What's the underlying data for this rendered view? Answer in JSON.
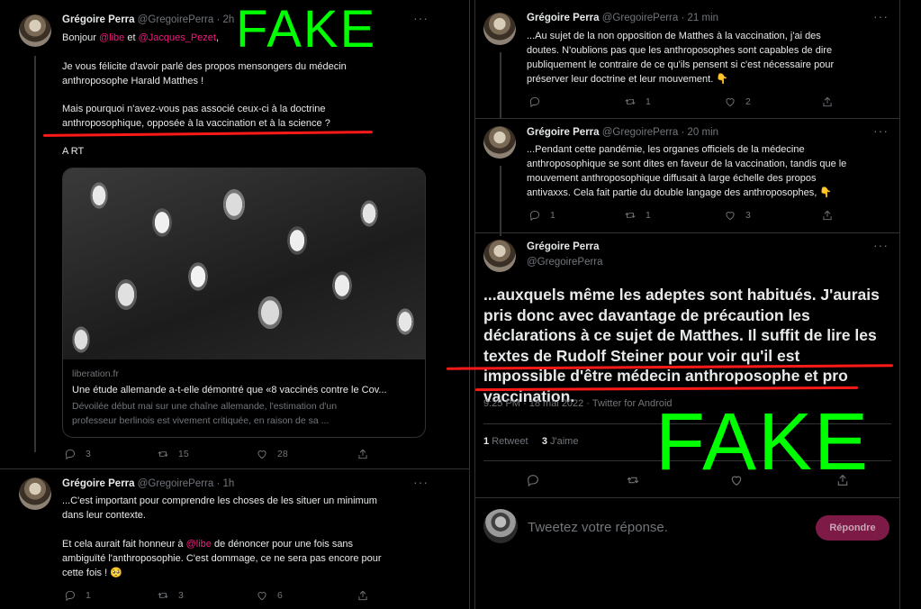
{
  "left": {
    "tweet1": {
      "name": "Grégoire Perra",
      "handle": "@GregoirePerra · 2h",
      "greeting_pre": "Bonjour ",
      "mention1": "@libe",
      "greeting_mid": " et ",
      "mention2": "@Jacques_Pezet",
      "greeting_post": ",",
      "para1": "Je vous félicite d'avoir parlé des propos mensongers du médecin\nanthroposophe Harald Matthes !",
      "para2": "Mais pourquoi n'avez-vous pas associé ceux-ci à la doctrine\nanthroposophique, opposée à la vaccination et à la science ?",
      "para3": "A RT",
      "card": {
        "domain": "liberation.fr",
        "title": "Une étude allemande a-t-elle démontré que «8 vaccinés contre le Cov...",
        "desc": "Dévoilée début mai sur une chaîne allemande, l'estimation d'un\nprofesseur berlinois est vivement critiquée, en raison de sa ..."
      },
      "replies": "3",
      "retweets": "15",
      "likes": "28"
    },
    "tweet2": {
      "name": "Grégoire Perra",
      "handle": "@GregoirePerra · 1h",
      "para1": "...C'est important pour comprendre les choses de les situer un minimum\ndans leur contexte.",
      "para2_pre": "Et cela aurait fait honneur à ",
      "mention": "@libe",
      "para2_post": " de dénoncer pour une fois sans",
      "para2_rest": "ambiguïté l'anthroposophie. C'est dommage, ce ne sera pas encore pour\ncette fois ! 🥺",
      "replies": "1",
      "retweets": "3",
      "likes": "6"
    }
  },
  "right": {
    "tweet1": {
      "name": "Grégoire Perra",
      "handle": "@GregoirePerra · 21 min",
      "text": "...Au sujet de la non opposition de Matthes à  la vaccination, j'ai des\ndoutes. N'oublions pas que les anthroposophes sont capables de dire\npubliquement le contraire de ce qu'ils pensent si c'est nécessaire pour\npréserver leur doctrine et leur mouvement. 👇",
      "replies": "",
      "retweets": "1",
      "likes": "2"
    },
    "tweet2": {
      "name": "Grégoire Perra",
      "handle": "@GregoirePerra · 20 min",
      "text": "...Pendant cette pandémie, les organes officiels de la médecine\nanthroposophique se sont dites en faveur de la vaccination, tandis que le\nmouvement anthroposophique diffusait à large échelle des propos\nantivaxxs. Cela fait partie du double langage des anthroposophes, 👇",
      "replies": "1",
      "retweets": "1",
      "likes": "3"
    },
    "main": {
      "name": "Grégoire Perra",
      "handle": "@GregoirePerra",
      "text": "...auxquels même les adeptes sont habitués. J'aurais pris donc avec davantage de précaution les déclarations à ce sujet de Matthes. Il suffit de lire les textes de Rudolf Steiner pour voir qu'il est impossible d'être médecin anthroposophe et pro vaccination.",
      "meta": "9:25 PM · 18 mai 2022 · Twitter for Android",
      "retweet_count": "1",
      "retweet_label": "Retweet",
      "like_count": "3",
      "like_label": "J'aime"
    },
    "reply": {
      "placeholder": "Tweetez votre réponse.",
      "button": "Répondre"
    }
  },
  "overlay": {
    "fake_text": "FAKE",
    "fake_color": "#00ff00",
    "underline_color": "#ff1a1a"
  },
  "icons": [
    "reply-icon",
    "retweet-icon",
    "like-icon",
    "share-icon",
    "more-icon"
  ]
}
